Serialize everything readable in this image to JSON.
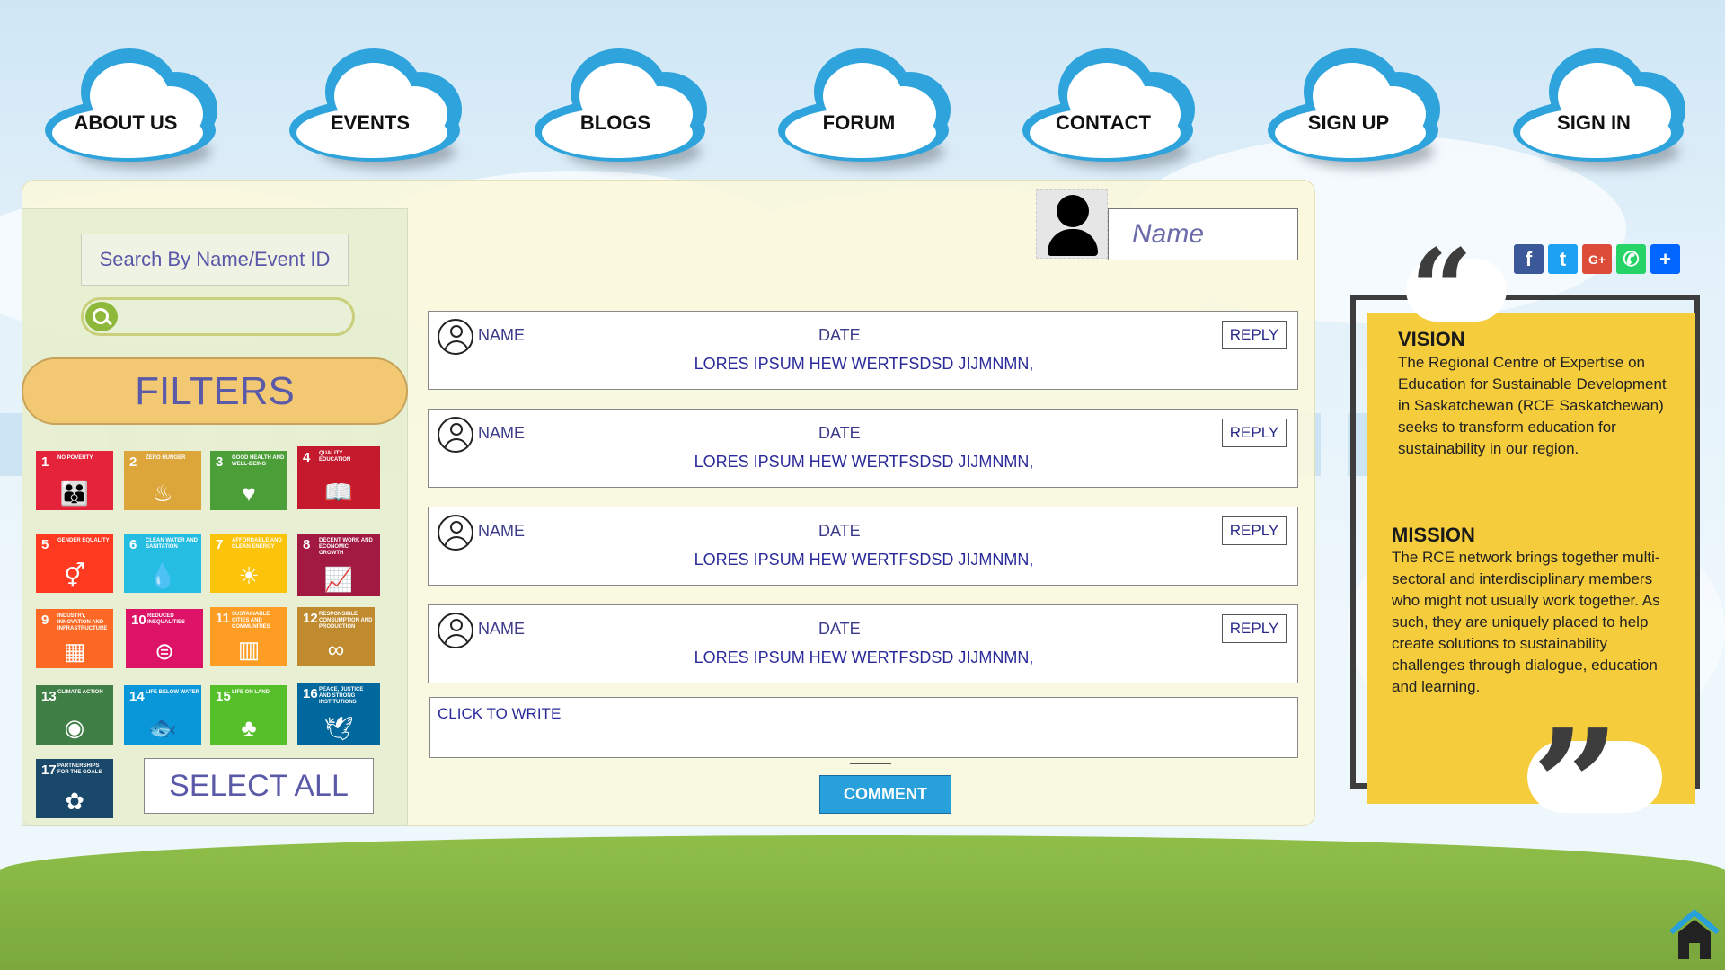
{
  "nav": {
    "items": [
      {
        "label": "ABOUT US"
      },
      {
        "label": "EVENTS"
      },
      {
        "label": "BLOGS"
      },
      {
        "label": "FORUM"
      },
      {
        "label": "CONTACT"
      },
      {
        "label": "SIGN UP"
      },
      {
        "label": "SIGN IN"
      }
    ]
  },
  "search": {
    "label": "Search By Name/Event ID",
    "value": ""
  },
  "filters": {
    "label": "FILTERS",
    "select_all": "SELECT ALL"
  },
  "sdgs": [
    {
      "num": "1",
      "text": "NO POVERTY",
      "color": "#e5243b",
      "icon": "family-icon"
    },
    {
      "num": "2",
      "text": "ZERO HUNGER",
      "color": "#dda63a",
      "icon": "bowl-icon"
    },
    {
      "num": "3",
      "text": "GOOD HEALTH AND WELL-BEING",
      "color": "#4c9f38",
      "icon": "heartbeat-icon"
    },
    {
      "num": "4",
      "text": "QUALITY EDUCATION",
      "color": "#c5192d",
      "icon": "book-icon"
    },
    {
      "num": "5",
      "text": "GENDER EQUALITY",
      "color": "#ff3a21",
      "icon": "gender-icon"
    },
    {
      "num": "6",
      "text": "CLEAN WATER AND SANITATION",
      "color": "#26bde2",
      "icon": "water-icon"
    },
    {
      "num": "7",
      "text": "AFFORDABLE AND CLEAN ENERGY",
      "color": "#fcc30b",
      "icon": "sun-icon"
    },
    {
      "num": "8",
      "text": "DECENT WORK AND ECONOMIC GROWTH",
      "color": "#a21942",
      "icon": "growth-icon"
    },
    {
      "num": "9",
      "text": "INDUSTRY, INNOVATION AND INFRASTRUCTURE",
      "color": "#fd6925",
      "icon": "cubes-icon"
    },
    {
      "num": "10",
      "text": "REDUCED INEQUALITIES",
      "color": "#dd1367",
      "icon": "equal-icon"
    },
    {
      "num": "11",
      "text": "SUSTAINABLE CITIES AND COMMUNITIES",
      "color": "#fd9d24",
      "icon": "city-icon"
    },
    {
      "num": "12",
      "text": "RESPONSIBLE CONSUMPTION AND PRODUCTION",
      "color": "#bf8b2e",
      "icon": "infinity-icon"
    },
    {
      "num": "13",
      "text": "CLIMATE ACTION",
      "color": "#3f7e44",
      "icon": "eye-globe-icon"
    },
    {
      "num": "14",
      "text": "LIFE BELOW WATER",
      "color": "#0a97d9",
      "icon": "fish-icon"
    },
    {
      "num": "15",
      "text": "LIFE ON LAND",
      "color": "#56c02b",
      "icon": "tree-icon"
    },
    {
      "num": "16",
      "text": "PEACE, JUSTICE AND STRONG INSTITUTIONS",
      "color": "#00689d",
      "icon": "dove-icon"
    },
    {
      "num": "17",
      "text": "PARTNERSHIPS FOR THE GOALS",
      "color": "#19486a",
      "icon": "rings-icon"
    }
  ],
  "user": {
    "name_placeholder": "Name"
  },
  "comments": [
    {
      "name": "NAME",
      "date": "DATE",
      "reply": "REPLY",
      "text": "LORES IPSUM HEW WERTFSDSD JIJMNMN,"
    },
    {
      "name": "NAME",
      "date": "DATE",
      "reply": "REPLY",
      "text": "LORES IPSUM HEW WERTFSDSD JIJMNMN,"
    },
    {
      "name": "NAME",
      "date": "DATE",
      "reply": "REPLY",
      "text": "LORES IPSUM HEW WERTFSDSD JIJMNMN,"
    },
    {
      "name": "NAME",
      "date": "DATE",
      "reply": "REPLY",
      "text": "LORES IPSUM HEW WERTFSDSD JIJMNMN,"
    }
  ],
  "composer": {
    "placeholder": "CLICK TO WRITE",
    "button": "COMMENT"
  },
  "share": [
    {
      "icon": "facebook-icon",
      "glyph": "f",
      "color": "#3b5998"
    },
    {
      "icon": "twitter-icon",
      "glyph": "t",
      "color": "#1da1f2"
    },
    {
      "icon": "google-plus-icon",
      "glyph": "G+",
      "color": "#dd4b39"
    },
    {
      "icon": "whatsapp-icon",
      "glyph": "✆",
      "color": "#25d366"
    },
    {
      "icon": "share-plus-icon",
      "glyph": "+",
      "color": "#0166ff"
    }
  ],
  "vision": {
    "title": "VISION",
    "text": "The Regional Centre of Expertise on Education for Sustainable Development in Saskatchewan (RCE Saskatchewan) seeks to transform education for sustainability in our region."
  },
  "mission": {
    "title": "MISSION",
    "text": "The RCE network brings together multi-sectoral and interdisciplinary members who might not usually work together. As such, they are uniquely placed to help create solutions to sustainability challenges through dialogue, education and learning."
  },
  "colors": {
    "accent": "#27a0dc",
    "card": "#f4cc3c",
    "filters": "#f2c873"
  }
}
